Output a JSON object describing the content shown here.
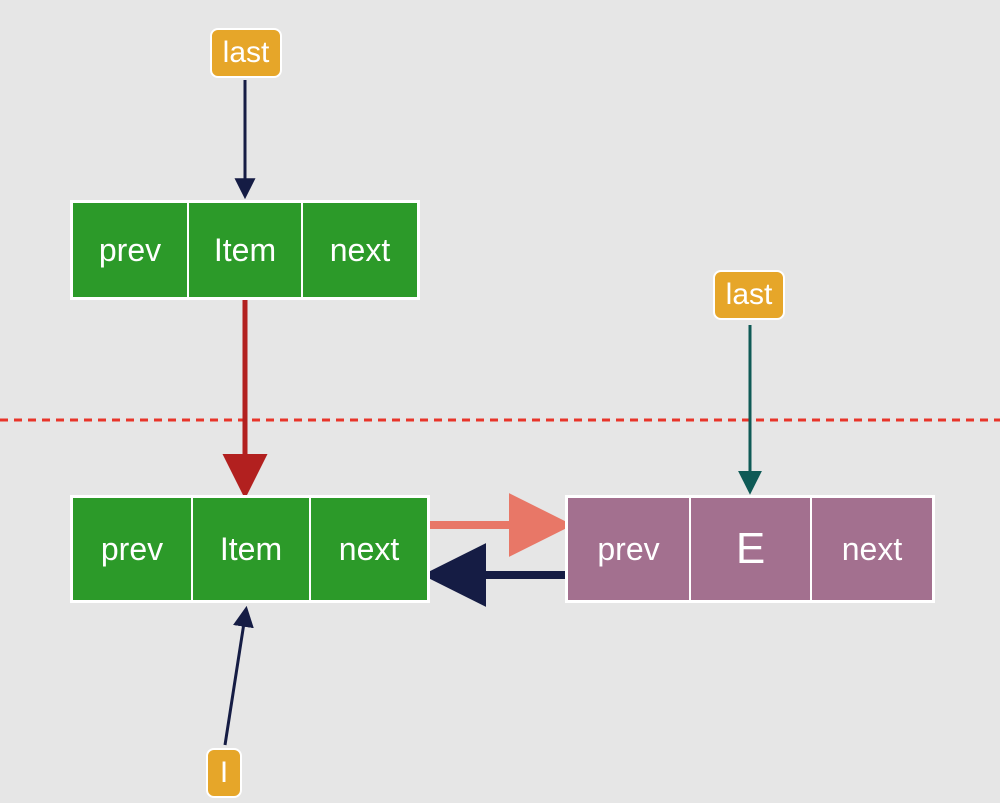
{
  "labels": {
    "last_top": "last",
    "last_right": "last",
    "i_bottom": "I"
  },
  "nodes": {
    "top_green": {
      "prev": "prev",
      "item": "Item",
      "next": "next"
    },
    "bottom_green": {
      "prev": "prev",
      "item": "Item",
      "next": "next"
    },
    "purple": {
      "prev": "prev",
      "item": "E",
      "next": "next"
    }
  },
  "colors": {
    "green": "#2c9a29",
    "purple": "#a3708f",
    "orange": "#e6a629",
    "arrow_navy": "#151c44",
    "arrow_red": "#b2201f",
    "arrow_salmon": "#e87767",
    "arrow_teal": "#0e5a56",
    "divider": "#e8352a"
  }
}
